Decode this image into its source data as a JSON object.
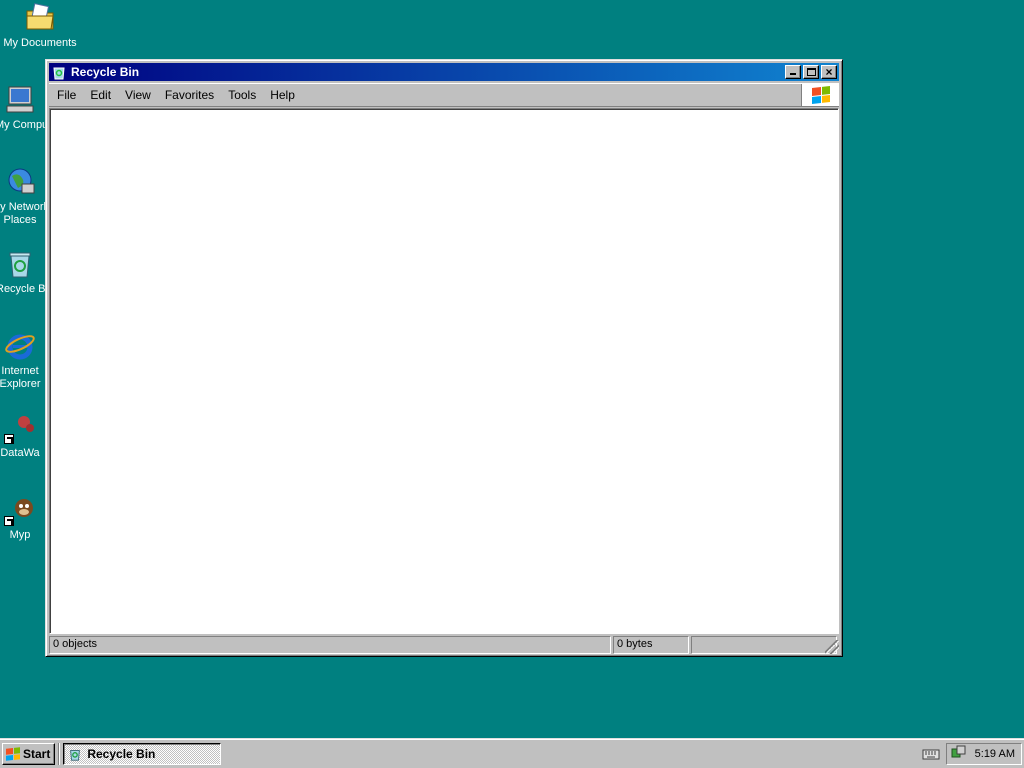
{
  "desktop": {
    "icons": [
      {
        "label": "My Documents",
        "icon": "my-documents-icon"
      },
      {
        "label": "My Computer",
        "icon": "my-computer-icon"
      },
      {
        "label": "My Network Places",
        "icon": "network-places-icon"
      },
      {
        "label": "Recycle Bin",
        "icon": "recycle-bin-icon"
      },
      {
        "label": "Internet Explorer",
        "icon": "internet-explorer-icon"
      },
      {
        "label": "DataWa",
        "icon": "datawa-shortcut-icon"
      },
      {
        "label": "Myp",
        "icon": "myp-shortcut-icon"
      }
    ]
  },
  "window": {
    "title": "Recycle Bin",
    "menu": [
      "File",
      "Edit",
      "View",
      "Favorites",
      "Tools",
      "Help"
    ],
    "status": {
      "objects": "0 objects",
      "bytes": "0 bytes"
    }
  },
  "taskbar": {
    "start_label": "Start",
    "task_label": "Recycle Bin",
    "clock": "5:19 AM"
  },
  "colors": {
    "desktop": "#008080",
    "title_active": "#000080",
    "face": "#c0c0c0"
  }
}
